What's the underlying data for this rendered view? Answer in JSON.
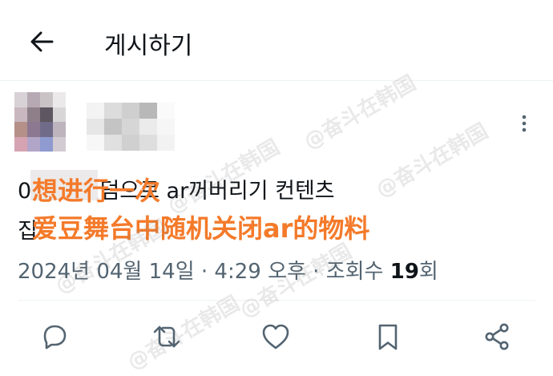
{
  "header": {
    "title": "게시하기",
    "back_icon": "arrow-left-icon"
  },
  "post": {
    "text_line1": "0…에 랜덤으로 ar꺼버리기 컨텐츠",
    "text_line2": "집",
    "overlay_line1": "想进行一次",
    "overlay_line2": "爱豆舞台中随机关闭ar的物料",
    "overlay_color": "#f47a2a",
    "date_time": "2024년 04월 14일 · 4:29 오후 · 조회수 ",
    "views": "19",
    "views_suffix": "회"
  },
  "actions": [
    "reply-icon",
    "repost-icon",
    "like-icon",
    "bookmark-icon",
    "share-icon"
  ],
  "watermark": "@奋斗在韩国"
}
